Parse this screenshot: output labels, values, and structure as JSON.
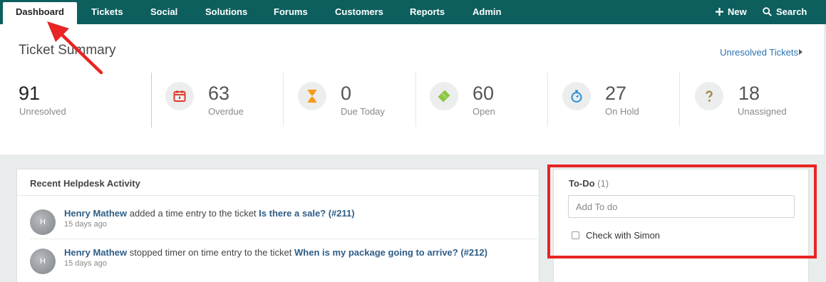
{
  "nav": {
    "tabs": [
      "Dashboard",
      "Tickets",
      "Social",
      "Solutions",
      "Forums",
      "Customers",
      "Reports",
      "Admin"
    ],
    "new_label": "New",
    "search_label": "Search"
  },
  "summary": {
    "title": "Ticket Summary",
    "link": "Unresolved Tickets",
    "stats": [
      {
        "value": "91",
        "label": "Unresolved"
      },
      {
        "value": "63",
        "label": "Overdue",
        "icon": "calendar-icon",
        "color": "#e03c31"
      },
      {
        "value": "0",
        "label": "Due Today",
        "icon": "hourglass-icon",
        "color": "#f39a1d"
      },
      {
        "value": "60",
        "label": "Open",
        "icon": "ticket-icon",
        "color": "#8dc63f"
      },
      {
        "value": "27",
        "label": "On Hold",
        "icon": "stopwatch-icon",
        "color": "#2a8fd6"
      },
      {
        "value": "18",
        "label": "Unassigned",
        "icon": "question-icon",
        "color": "#a88b4e"
      }
    ]
  },
  "activity": {
    "title": "Recent Helpdesk Activity",
    "items": [
      {
        "avatar": "H",
        "who": "Henry Mathew",
        "action": "added a time entry to the ticket",
        "what": "Is there a sale? (#211)",
        "time": "15 days ago"
      },
      {
        "avatar": "H",
        "who": "Henry Mathew",
        "action": "stopped timer on time entry to the ticket",
        "what": "When is my package going to arrive? (#212)",
        "time": "15 days ago"
      }
    ]
  },
  "todo": {
    "title": "To-Do",
    "count": "(1)",
    "placeholder": "Add To do",
    "items": [
      {
        "label": "Check with Simon",
        "checked": false
      }
    ]
  },
  "colors": {
    "nav": "#0d5f5e",
    "annotation": "#e82424",
    "link": "#2a72b5"
  }
}
